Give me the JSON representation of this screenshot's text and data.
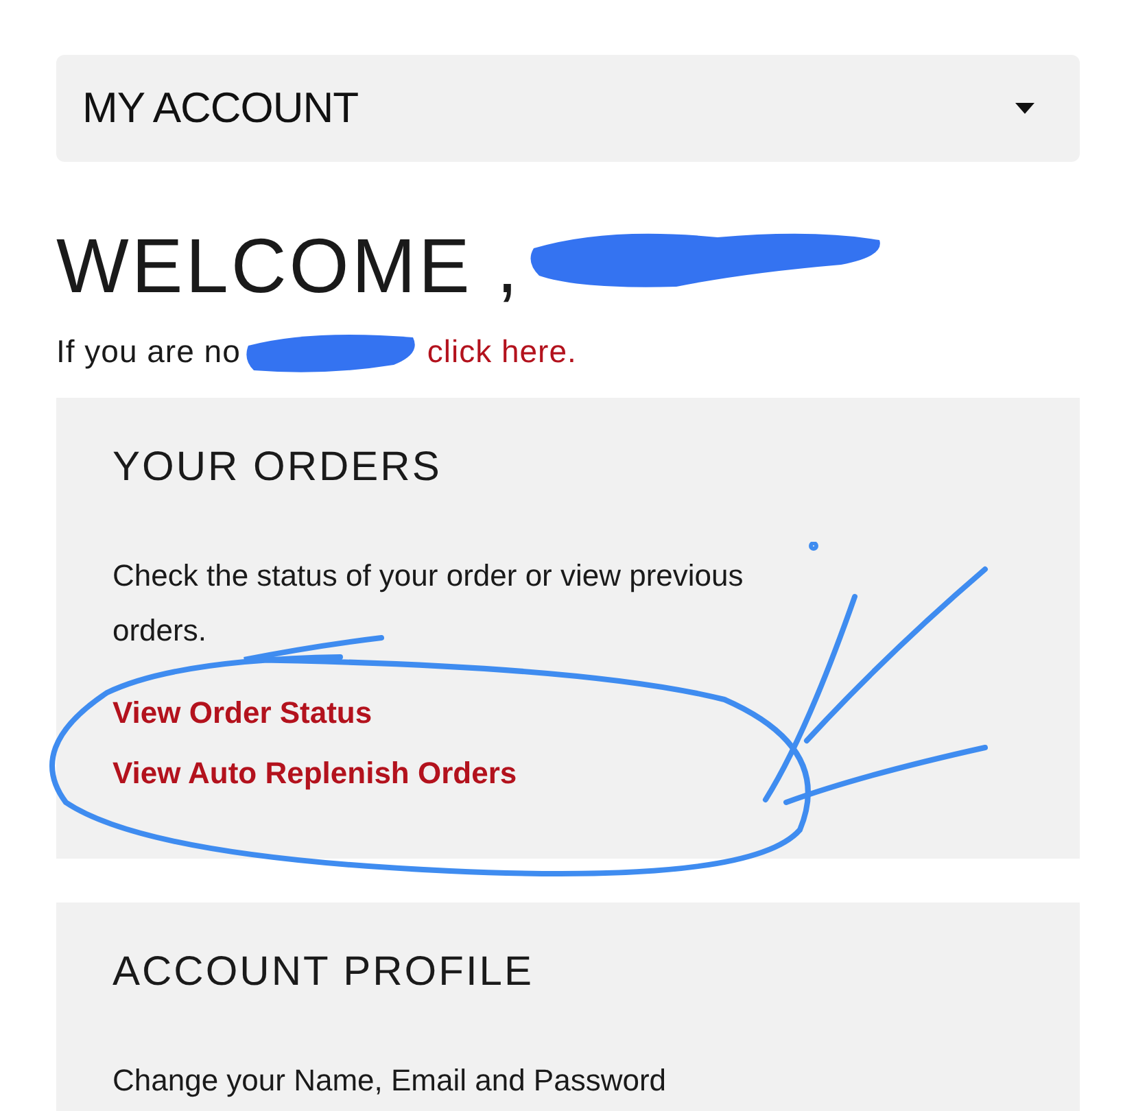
{
  "account_menu": {
    "label": "MY ACCOUNT"
  },
  "welcome": {
    "heading": "WELCOME ,"
  },
  "notice": {
    "text": "If you are no",
    "link": "click here."
  },
  "sections": [
    {
      "title": "YOUR ORDERS",
      "description": "Check the status of your order or view previous orders.",
      "links": [
        "View Order Status",
        "View Auto Replenish Orders"
      ]
    },
    {
      "title": "ACCOUNT PROFILE",
      "description": "Change your Name, Email and Password"
    }
  ]
}
